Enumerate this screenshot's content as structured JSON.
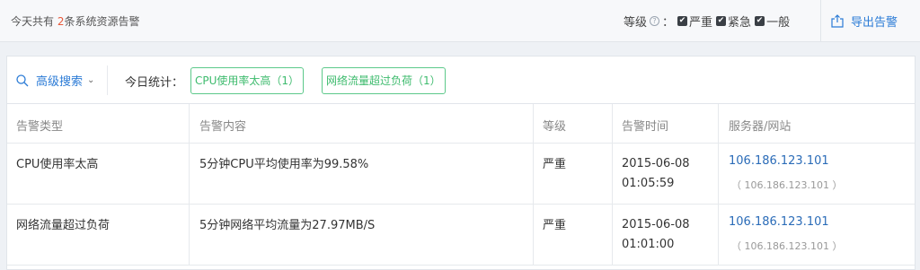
{
  "header": {
    "summary_prefix": "今天共有",
    "summary_count": "2",
    "summary_suffix": "条系统资源告警",
    "level_label": "等级",
    "help_icon": "?",
    "level_colon": "：",
    "levels": [
      {
        "label": "严重",
        "checked": true
      },
      {
        "label": "紧急",
        "checked": true
      },
      {
        "label": "一般",
        "checked": true
      }
    ],
    "export_label": "导出告警"
  },
  "toolbar": {
    "advanced_search_label": "高级搜索",
    "today_stats_label": "今日统计：",
    "tags": [
      "CPU使用率太高（1）",
      "网络流量超过负荷（1）"
    ]
  },
  "table": {
    "columns": [
      "告警类型",
      "告警内容",
      "等级",
      "告警时间",
      "服务器/网站"
    ],
    "rows": [
      {
        "type": "CPU使用率太高",
        "content": "5分钟CPU平均使用率为99.58%",
        "level": "严重",
        "date": "2015-06-08",
        "time": "01:05:59",
        "server": "106.186.123.101",
        "server_sub": "（ 106.186.123.101 ）"
      },
      {
        "type": "网络流量超过负荷",
        "content": "5分钟网络平均流量为27.97MB/S",
        "level": "严重",
        "date": "2015-06-08",
        "time": "01:01:00",
        "server": "106.186.123.101",
        "server_sub": "（ 106.186.123.101 ）"
      }
    ]
  },
  "colors": {
    "accent": "#2b7bd6",
    "count_highlight": "#e8593a",
    "tag_green": "#3dbb6d"
  }
}
